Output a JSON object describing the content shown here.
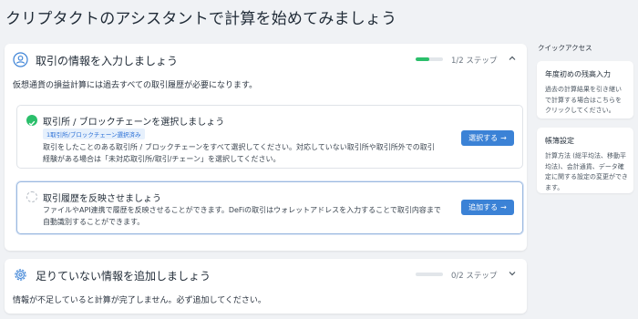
{
  "page": {
    "title": "クリプタクトのアシスタントで計算を始めてみましょう"
  },
  "transactions_card": {
    "title": "取引の情報を入力しましょう",
    "progress": {
      "text": "1/2 ステップ",
      "fraction": 0.5,
      "color": "#2bbf6b"
    },
    "description": "仮想通貨の損益計算には過去すべての取引履歴が必要になります。",
    "steps": [
      {
        "title": "取引所 / ブロックチェーンを選択しましょう",
        "status": "completed",
        "badge": "1取引所/ブロックチェーン選択済み",
        "text_lines": [
          "取引をしたことのある取引所 / ブロックチェーンをすべて選択してください。対応していない取引所や取引所外での取引",
          "経験がある場合は「未対応取引所/取引/チェーン」を選択してください。"
        ],
        "button_label": "選択する"
      },
      {
        "title": "取引履歴を反映させましょう",
        "status": "pending",
        "text_lines": [
          "ファイルやAPI連携で履歴を反映させることができます。DeFiの取引はウォレットアドレスを入力することで取引内容まで",
          "自動識別することができます。"
        ],
        "button_label": "追加する"
      }
    ]
  },
  "missing_info_card": {
    "title": "足りていない情報を追加しましょう",
    "progress": {
      "text": "0/2 ステップ",
      "fraction": 0
    },
    "description": "情報が不足していると計算が完了しません。必ず追加してください。"
  },
  "quick_access": {
    "heading": "クイックアクセス",
    "cards": [
      {
        "title": "年度初めの残高入力",
        "text_lines": [
          "過去の計算結果を引き継い",
          "で計算する場合はこちらを",
          "クリックしてください。"
        ]
      },
      {
        "title": "帳簿設定",
        "text_lines": [
          "計算方法 (総平均法、移動平",
          "均法)、会計通貨、データ確",
          "定に関する設定の変更ができ",
          "ます。"
        ]
      }
    ]
  },
  "colors": {
    "accent": "#3b82d6",
    "success": "#2bbf6b",
    "background": "#f0f2f5"
  }
}
